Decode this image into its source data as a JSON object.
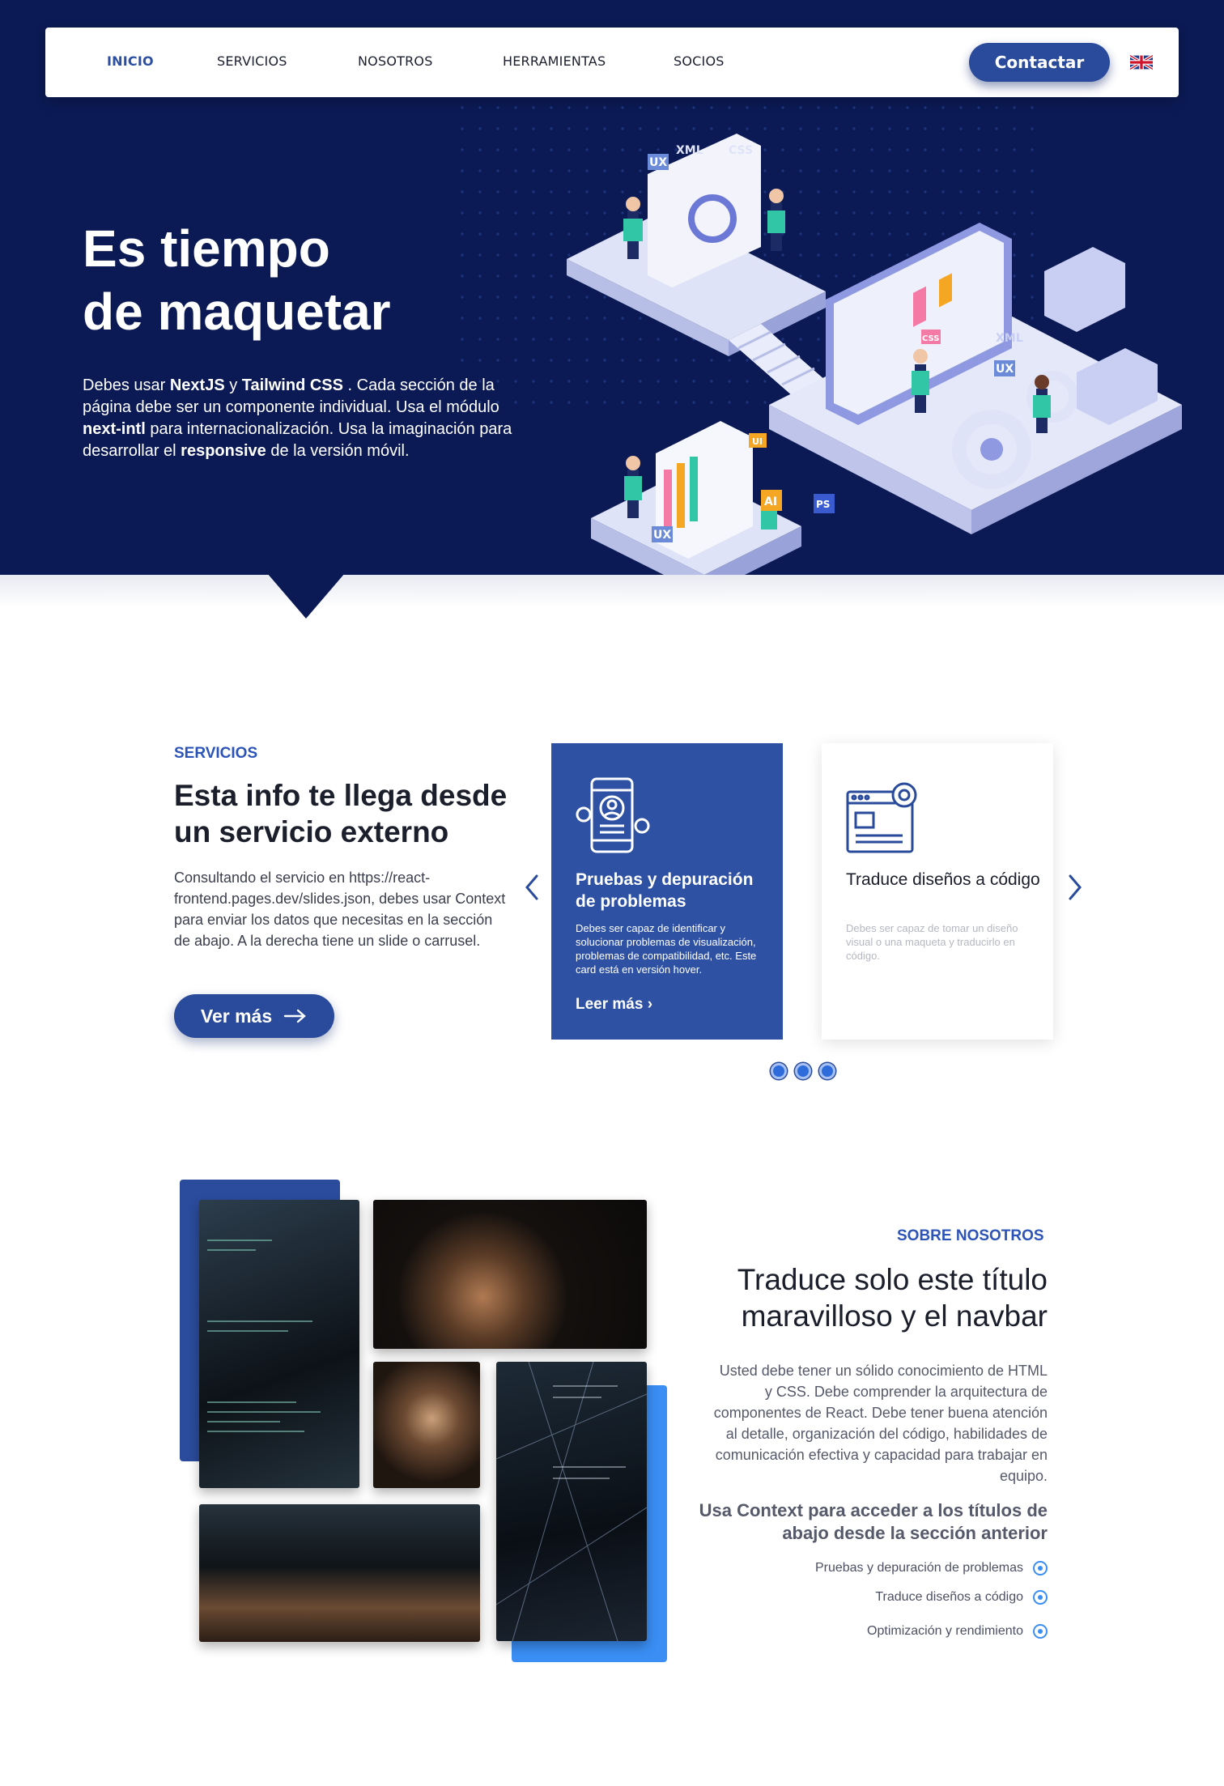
{
  "nav": {
    "items": [
      "INICIO",
      "SERVICIOS",
      "NOSOTROS",
      "HERRAMIENTAS",
      "SOCIOS"
    ],
    "active": "INICIO",
    "contact_label": "Contactar",
    "language_icon": "uk-flag-icon"
  },
  "hero": {
    "title_line1": "Es tiempo",
    "title_line2": "de maquetar",
    "text": {
      "p1": "Debes usar ",
      "b1": "NextJS",
      "p2": " y ",
      "b2": "Tailwind CSS",
      "p3": " . Cada sección de la página debe ser un componente individual. Usa el módulo ",
      "b3": "next-intl",
      "p4": " para internacionalización. Usa la imaginación para desarrollar el ",
      "b4": "responsive",
      "p5": " de la versión móvil."
    },
    "badges": [
      "UX",
      "XML",
      "CSS",
      "UX",
      "XML",
      "CSS",
      "UI",
      "AI",
      "PS",
      "UX"
    ]
  },
  "services": {
    "kicker": "SERVICIOS",
    "title": "Esta info te llega desde un servicio externo",
    "text": "Consultando el servicio en https://react-frontend.pages.dev/slides.json, debes usar Context para enviar los datos que necesitas en la sección de abajo. A la derecha tiene un slide o carrusel.",
    "button": "Ver más",
    "cards": [
      {
        "title": "Pruebas y depuración de problemas",
        "desc": "Debes ser capaz de identificar y solucionar problemas de visualización, problemas de compatibilidad, etc. Este card está en versión hover.",
        "link": "Leer más",
        "icon": "mobile-profile-gear-icon"
      },
      {
        "title": "Traduce diseños a código",
        "desc": "Debes ser capaz de tomar un diseño visual o una maqueta y traducirlo en código.",
        "icon": "browser-window-gear-icon"
      }
    ],
    "dots": 3
  },
  "about": {
    "kicker": "SOBRE NOSOTROS",
    "title": "Traduce solo este título maravilloso y el navbar",
    "text": "Usted debe tener un sólido conocimiento de HTML y CSS. Debe comprender la arquitectura de componentes de React. Debe tener buena atención al detalle, organización del código, habilidades de comunicación efectiva y capacidad para trabajar en equipo.",
    "subtitle": "Usa Context para acceder a los títulos de abajo desde la sección anterior",
    "list": [
      "Pruebas y depuración de problemas",
      "Traduce diseños a código",
      "Optimización y rendimiento"
    ]
  },
  "colors": {
    "hero_bg": "#0b1a54",
    "primary": "#2a4b9b",
    "accent_blue": "#3a8ef4",
    "kicker": "#2c54b8"
  }
}
